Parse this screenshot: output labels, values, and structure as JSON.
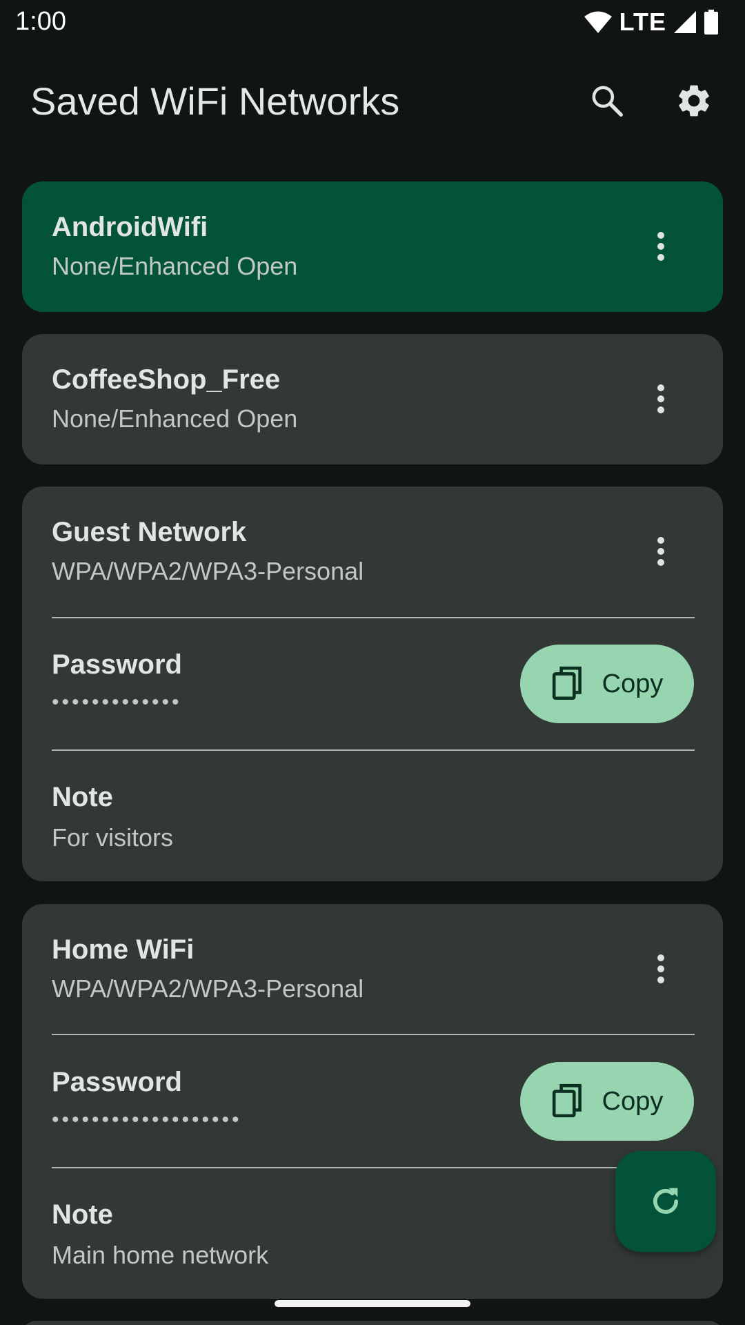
{
  "status_bar": {
    "time": "1:00",
    "network": "LTE"
  },
  "app_bar": {
    "title": "Saved WiFi Networks",
    "icons": [
      "search-icon",
      "settings-icon"
    ]
  },
  "networks": [
    {
      "name": "AndroidWifi",
      "security": "None/Enhanced Open",
      "active": true
    },
    {
      "name": "CoffeeShop_Free",
      "security": "None/Enhanced Open",
      "active": false
    },
    {
      "name": "Guest Network",
      "security": "WPA/WPA2/WPA3-Personal",
      "active": false,
      "password_label": "Password",
      "password_masked": "•••••••••••••",
      "copy_label": "Copy",
      "note_label": "Note",
      "note": "For visitors"
    },
    {
      "name": "Home WiFi",
      "security": "WPA/WPA2/WPA3-Personal",
      "active": false,
      "password_label": "Password",
      "password_masked": "•••••••••••••••••••",
      "copy_label": "Copy",
      "note_label": "Note",
      "note": "Main home network"
    }
  ],
  "fab": {
    "icon": "refresh-icon"
  },
  "colors": {
    "active_card": "#03533a",
    "card": "#323835",
    "accent_button": "#96d5b0",
    "background": "#101413"
  }
}
